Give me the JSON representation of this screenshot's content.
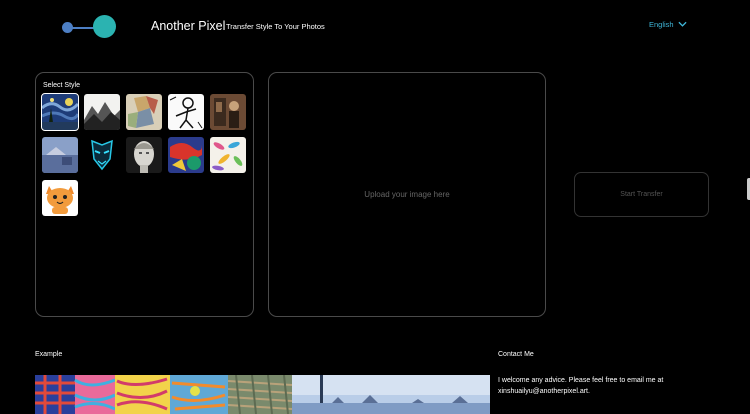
{
  "header": {
    "brand": "Another Pixel",
    "tagline": "Transfer Style To Your Photos",
    "language": "English",
    "colors": {
      "logo_blue": "#4d7fc4",
      "logo_teal": "#2bb3b1",
      "language": "#3fb6d8"
    }
  },
  "style_panel": {
    "title": "Select Style",
    "styles": [
      {
        "icon": "starry-night-thumb",
        "selected": true
      },
      {
        "icon": "ink-mountains-thumb",
        "selected": false
      },
      {
        "icon": "cubist-figure-thumb",
        "selected": false
      },
      {
        "icon": "sketch-figure-thumb",
        "selected": false
      },
      {
        "icon": "dark-portrait-thumb",
        "selected": false
      },
      {
        "icon": "blue-landscape-thumb",
        "selected": false
      },
      {
        "icon": "neon-mask-thumb",
        "selected": false
      },
      {
        "icon": "statue-head-thumb",
        "selected": false
      },
      {
        "icon": "abstract-shapes-thumb",
        "selected": false
      },
      {
        "icon": "feather-pattern-thumb",
        "selected": false
      },
      {
        "icon": "cartoon-cat-thumb",
        "selected": false
      }
    ]
  },
  "upload": {
    "placeholder": "Upload your image here"
  },
  "transfer": {
    "label": "Start Transfer"
  },
  "example": {
    "label": "Example"
  },
  "contact": {
    "label": "Contact Me",
    "text": "I welcome any advice. Please feel free to email me at xinshuailyu@anotherpixel.art."
  }
}
